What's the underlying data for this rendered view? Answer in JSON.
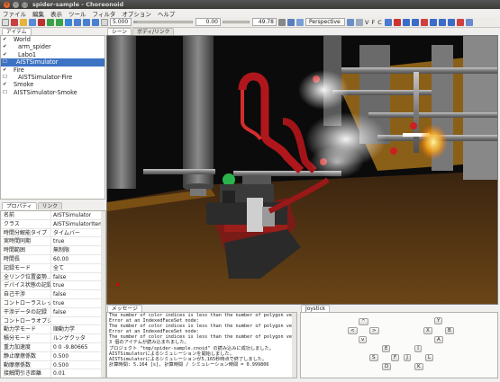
{
  "window": {
    "title": "spider-sample - Choreonoid"
  },
  "menu": [
    "ファイル",
    "編集",
    "表示",
    "ツール",
    "フィルタ",
    "オプション",
    "ヘルプ"
  ],
  "toolbar": {
    "time_value": "5.000",
    "current_time": "0.00",
    "end_time": "49.78",
    "slider_position": 0.05,
    "view_mode": "Perspective",
    "letters": [
      "V",
      "F",
      "C"
    ]
  },
  "items_panel": {
    "tab": "アイテム",
    "items": [
      {
        "label": "World",
        "checked": true,
        "selected": false
      },
      {
        "label": "arm_spider",
        "checked": true,
        "selected": false
      },
      {
        "label": "Labo1",
        "checked": true,
        "selected": false
      },
      {
        "label": "AISTSimulator",
        "checked": false,
        "selected": true
      },
      {
        "label": "Fire",
        "checked": true,
        "selected": false
      },
      {
        "label": "AISTSimulator-Fire",
        "checked": false,
        "selected": false
      },
      {
        "label": "Smoke",
        "checked": true,
        "selected": false
      },
      {
        "label": "AISTSimulator-Smoke",
        "checked": false,
        "selected": false
      }
    ]
  },
  "props_panel": {
    "tabs": [
      "プロパティ",
      "リンク"
    ],
    "rows": [
      {
        "key": "名前",
        "value": "AISTSimulator"
      },
      {
        "key": "クラス",
        "value": "AISTSimulatorItem"
      },
      {
        "key": "時間分解能タイプ",
        "value": "タイムバー"
      },
      {
        "key": "実時間同期",
        "value": "true"
      },
      {
        "key": "時間範囲",
        "value": "無制限"
      },
      {
        "key": "時間長",
        "value": "60.00"
      },
      {
        "key": "記録モード",
        "value": "全て"
      },
      {
        "key": "全リンク位置姿勢...",
        "value": "false"
      },
      {
        "key": "デバイス状態の記録",
        "value": "true"
      },
      {
        "key": "自己干渉",
        "value": "false"
      },
      {
        "key": "コントローラスレッド",
        "value": "true"
      },
      {
        "key": "干渉データの記録",
        "value": "false"
      },
      {
        "key": "コントローラオプション",
        "value": ""
      },
      {
        "key": "動力学モード",
        "value": "順動力学"
      },
      {
        "key": "積分モード",
        "value": "ルンゲクッタ"
      },
      {
        "key": "重力加速度",
        "value": "0  0  -9.80665"
      },
      {
        "key": "静止摩擦係数",
        "value": "0.500"
      },
      {
        "key": "動摩擦係数",
        "value": "0.500"
      },
      {
        "key": "接触間引き距離",
        "value": "0.01"
      },
      {
        "key": "接触間引き...",
        "value": "0.01"
      }
    ]
  },
  "scene_tabs": [
    "シーン",
    "ボディ/リンク"
  ],
  "message_panel": {
    "tab": "メッセージ",
    "lines": [
      "The number of color indices is less than the number of polygon vertices.",
      "Error at an IndexedFaceSet node:",
      "The number of color indices is less than the number of polygon vertices.",
      "Error at an IndexedFaceSet node:",
      "The number of color indices is less than the number of polygon vertices.",
      "3 個のアイテムが読み込まれました。",
      "プロジェクト \"tmp/spider-sample.cnoid\" の読み込みに成功しました。",
      "AISTSimulatorによるシミュレーションを開始しました。",
      "AISTSimulatorによるシミュレーションが5,165秒時点で終了しました。",
      "計算時間: 5.164 [s], 計算時間 / シミュレーション時間 = 0.999806"
    ]
  },
  "joystick_panel": {
    "tab": "Joystick",
    "buttons": {
      "up": "^",
      "left": "<",
      "right": ">",
      "down": "v",
      "Y": "Y",
      "X": "X",
      "B": "B",
      "A": "A",
      "E": "E",
      "I": "I",
      "S": "S",
      "F": "F",
      "J": "J",
      "L": "L",
      "D": "D",
      "K": "K"
    }
  },
  "colors": {
    "selection": "#3d73c3",
    "title_bar": "#3c3b37",
    "close_button": "#e2672f"
  }
}
